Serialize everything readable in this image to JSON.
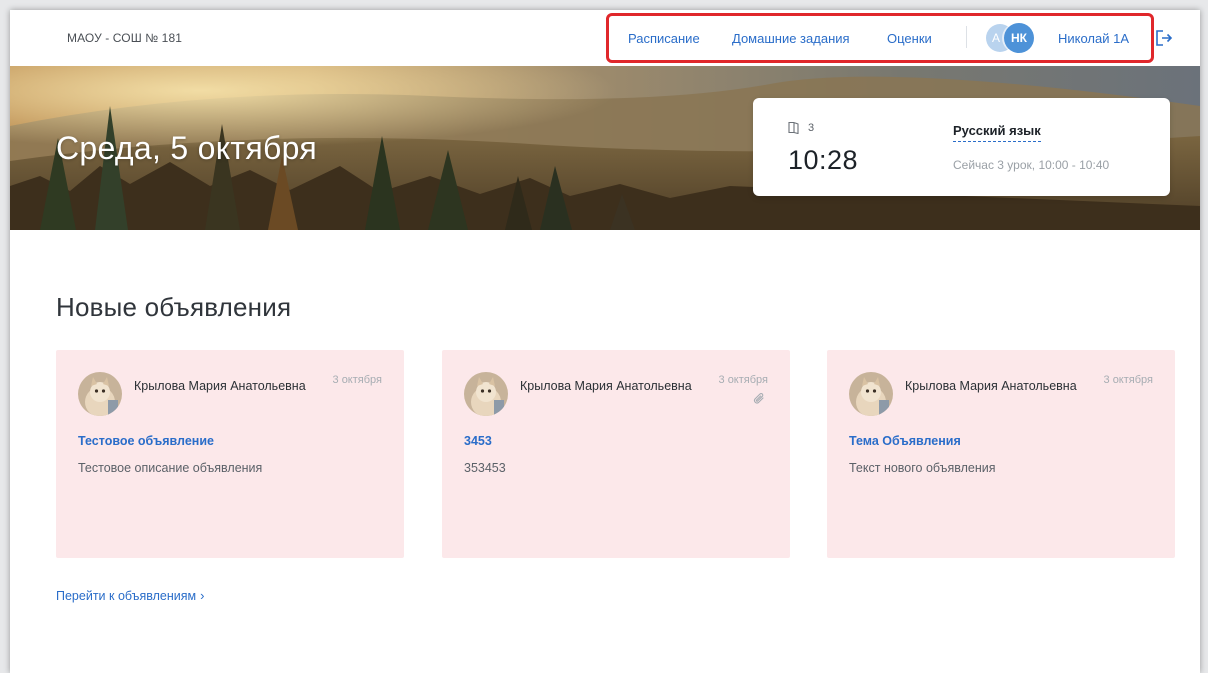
{
  "header": {
    "school": "МАОУ - СОШ № 181",
    "nav": {
      "schedule": "Расписание",
      "homework": "Домашние задания",
      "grades": "Оценки"
    },
    "avatar_back_initial": "А",
    "avatar_initials": "НК",
    "user_name": "Николай 1А",
    "logout_icon": "logout-icon"
  },
  "hero": {
    "date": "Среда, 5 октября",
    "lesson": {
      "number": "3",
      "time": "10:28",
      "subject": "Русский язык",
      "now": "Сейчас 3 урок, 10:00 - 10:40"
    }
  },
  "announcements": {
    "title": "Новые объявления",
    "items": [
      {
        "author": "Крылова Мария Анатольевна",
        "date": "3 октября",
        "title": "Тестовое объявление",
        "description": "Тестовое описание объявления",
        "has_attachment": false
      },
      {
        "author": "Крылова Мария Анатольевна",
        "date": "3 октября",
        "title": "3453",
        "description": "353453",
        "has_attachment": true
      },
      {
        "author": "Крылова Мария Анатольевна",
        "date": "3 октября",
        "title": "Тема Объявления",
        "description": "Текст нового объявления",
        "has_attachment": false
      }
    ],
    "all_link": "Перейти к объявлениям",
    "all_link_chevron": "›"
  },
  "colors": {
    "link": "#2a6dc9",
    "card_bg": "#fce8ea",
    "highlight": "#e0272b",
    "avatar": "#4d92d8"
  }
}
